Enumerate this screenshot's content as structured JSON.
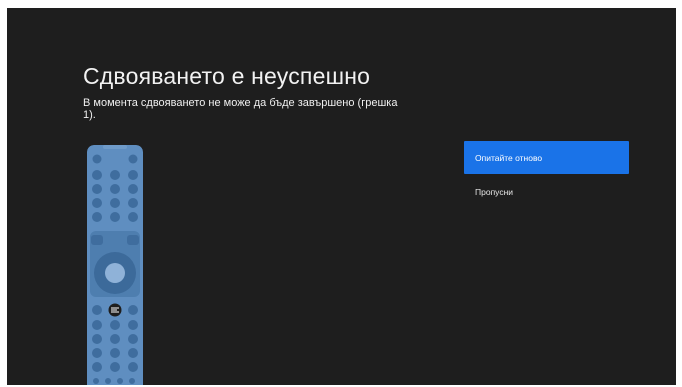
{
  "dialog": {
    "title": "Сдвояването е неуспешно",
    "message": "В момента сдвояването не може да бъде завършено (грешка 1)."
  },
  "illustration": {
    "icon": "tv-remote-illustration",
    "color": "#5f8ec0"
  },
  "actions": {
    "retry_label": "Опитайте отново",
    "skip_label": "Пропусни",
    "focused": "retry"
  },
  "colors": {
    "background": "#1e1e1e",
    "accent": "#1a73e8",
    "text": "#f0f0f0"
  }
}
